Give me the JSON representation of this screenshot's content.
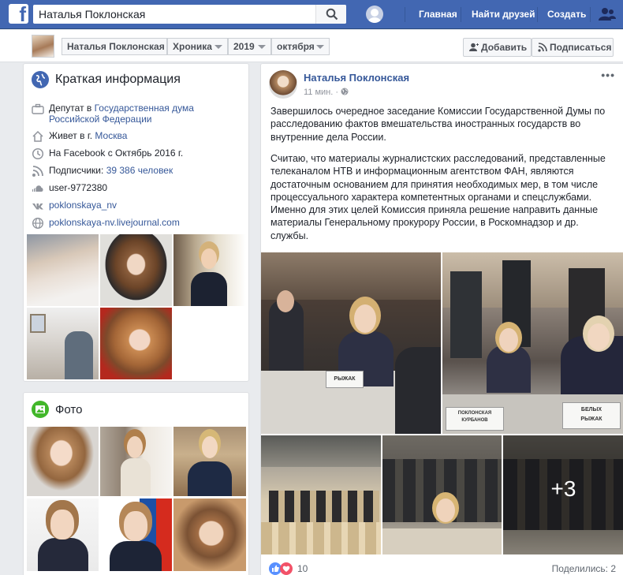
{
  "topbar": {
    "logo_letter": "f",
    "search_value": "Наталья Поклонская",
    "nav": [
      "Главная",
      "Найти друзей",
      "Создать"
    ],
    "color": "#4267b2"
  },
  "timeline": {
    "name": "Наталья Поклонская",
    "section": "Хроника",
    "year": "2019",
    "month": "октября",
    "add_label": "Добавить",
    "subscribe_label": "Подписаться"
  },
  "intro": {
    "title": "Краткая информация",
    "rows": [
      {
        "icon": "briefcase-icon",
        "prefix": "Депутат в ",
        "link": "Государственная дума Российской Федерации"
      },
      {
        "icon": "home-icon",
        "prefix": "Живет в г. ",
        "link": "Москва"
      },
      {
        "icon": "clock-icon",
        "prefix": "На Facebook с Октябрь 2016 г.",
        "link": ""
      },
      {
        "icon": "rss-icon",
        "prefix": "Подписчики: ",
        "link": "39 386 человек"
      },
      {
        "icon": "soundcloud-icon",
        "prefix": "user-9772380",
        "link": ""
      },
      {
        "icon": "vk-icon",
        "prefix": "",
        "link": "poklonskaya_nv"
      },
      {
        "icon": "globe-icon",
        "prefix": "",
        "link": "poklonskaya-nv.livejournal.com"
      }
    ]
  },
  "photos": {
    "title": "Фото"
  },
  "post": {
    "author": "Наталья Поклонская",
    "time": "11 мин.",
    "more": "•••",
    "paragraph1": "Завершилось очередное заседание Комиссии Государственной Думы по расследованию фактов вмешательства иностранных государств во внутренние дела России.",
    "paragraph2": "Считаю, что материалы журналистских расследований, представленные телеканалом НТВ и информационным агентством ФАН, являются достаточным основанием для принятия необходимых мер, в том числе процессуального характера компетентных органами и спецслужбами. Именно для этих целей Комиссия приняла решение направить данные материалы Генеральному прокурору России, в Роскомнадзор и др. службы.",
    "more_photos": "+3",
    "nameplates": [
      "РЫЖАК",
      "ПОКЛОНСКАЯ",
      "КУРБАНОВ",
      "БЕЛЫХ",
      "РЫЖАК"
    ],
    "reactions_count": "10",
    "shares": "Поделились: 2"
  }
}
